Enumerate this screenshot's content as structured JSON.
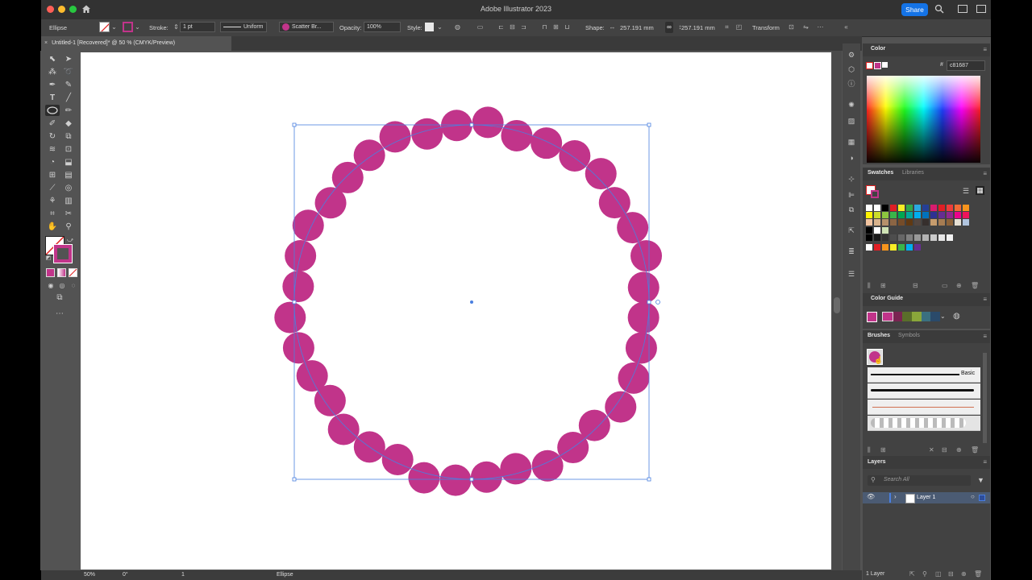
{
  "app": {
    "title": "Adobe Illustrator 2023",
    "share": "Share"
  },
  "control": {
    "selection": "Ellipse",
    "stroke_label": "Stroke:",
    "stroke_weight": "1 pt",
    "profile": "Uniform",
    "brush": "Scatter Br...",
    "opacity_label": "Opacity:",
    "opacity": "100%",
    "style_label": "Style:",
    "shape_label": "Shape:",
    "width": "257.191 mm",
    "height": "257.191 mm",
    "transform": "Transform"
  },
  "document": {
    "tab": "Untitled-1 [Recovered]* @ 50 % (CMYK/Preview)"
  },
  "status": {
    "zoom": "50%",
    "rotation": "0°",
    "artboard": "1",
    "tool": "Ellipse"
  },
  "color_panel": {
    "title": "Color",
    "hex_label": "#",
    "hex": "c81687"
  },
  "swatches": {
    "tabs": [
      "Swatches",
      "Libraries"
    ]
  },
  "color_guide": {
    "title": "Color Guide"
  },
  "brushes": {
    "tabs": [
      "Brushes",
      "Symbols"
    ],
    "basic_label": "Basic"
  },
  "layers": {
    "title": "Layers",
    "search_placeholder": "Search All",
    "layer_name": "Layer 1",
    "count": "1 Layer"
  },
  "colors": {
    "accent": "#c1348a",
    "selection": "#4a7fe0",
    "brand_blue": "#1473e6"
  }
}
